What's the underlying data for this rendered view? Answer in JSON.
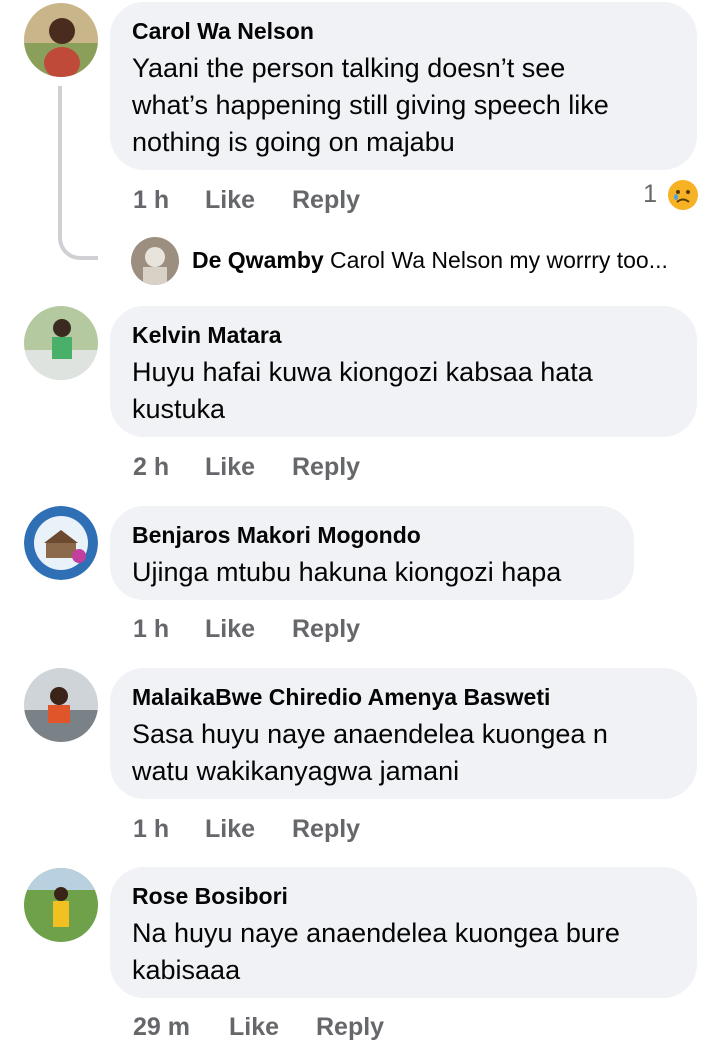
{
  "comments": [
    {
      "name": "Carol Wa Nelson",
      "text_lines": [
        "Yaani the person talking doesn’t see",
        "what’s happening still giving speech like",
        "nothing is going on majabu"
      ],
      "time": "1 h",
      "like": "Like",
      "reply": "Reply",
      "reaction_count": "1",
      "reaction_icon": "sad-face-icon"
    },
    {
      "name": "Kelvin Matara",
      "text_lines": [
        "Huyu hafai kuwa kiongozi kabsaa hata",
        "kustuka"
      ],
      "time": "2 h",
      "like": "Like",
      "reply": "Reply"
    },
    {
      "name": "Benjaros Makori Mogondo",
      "text_lines": [
        "Ujinga mtubu hakuna kiongozi hapa"
      ],
      "time": "1 h",
      "like": "Like",
      "reply": "Reply"
    },
    {
      "name": "MalaikaBwe Chiredio Amenya Basweti",
      "text_lines": [
        "Sasa huyu naye anaendelea kuongea n",
        "watu wakikanyagwa jamani"
      ],
      "time": "1 h",
      "like": "Like",
      "reply": "Reply"
    },
    {
      "name": "Rose Bosibori",
      "text_lines": [
        "Na huyu naye anaendelea kuongea bure",
        "kabisaaa"
      ],
      "time": "29 m",
      "like": "Like",
      "reply": "Reply"
    }
  ],
  "reply_preview": {
    "name": "De Qwamby",
    "text": "Carol Wa Nelson my worrry too..."
  },
  "colors": {
    "bubble": "#f0f2f5",
    "meta": "#65676b",
    "text": "#050505",
    "emoji": "#f7b125"
  }
}
